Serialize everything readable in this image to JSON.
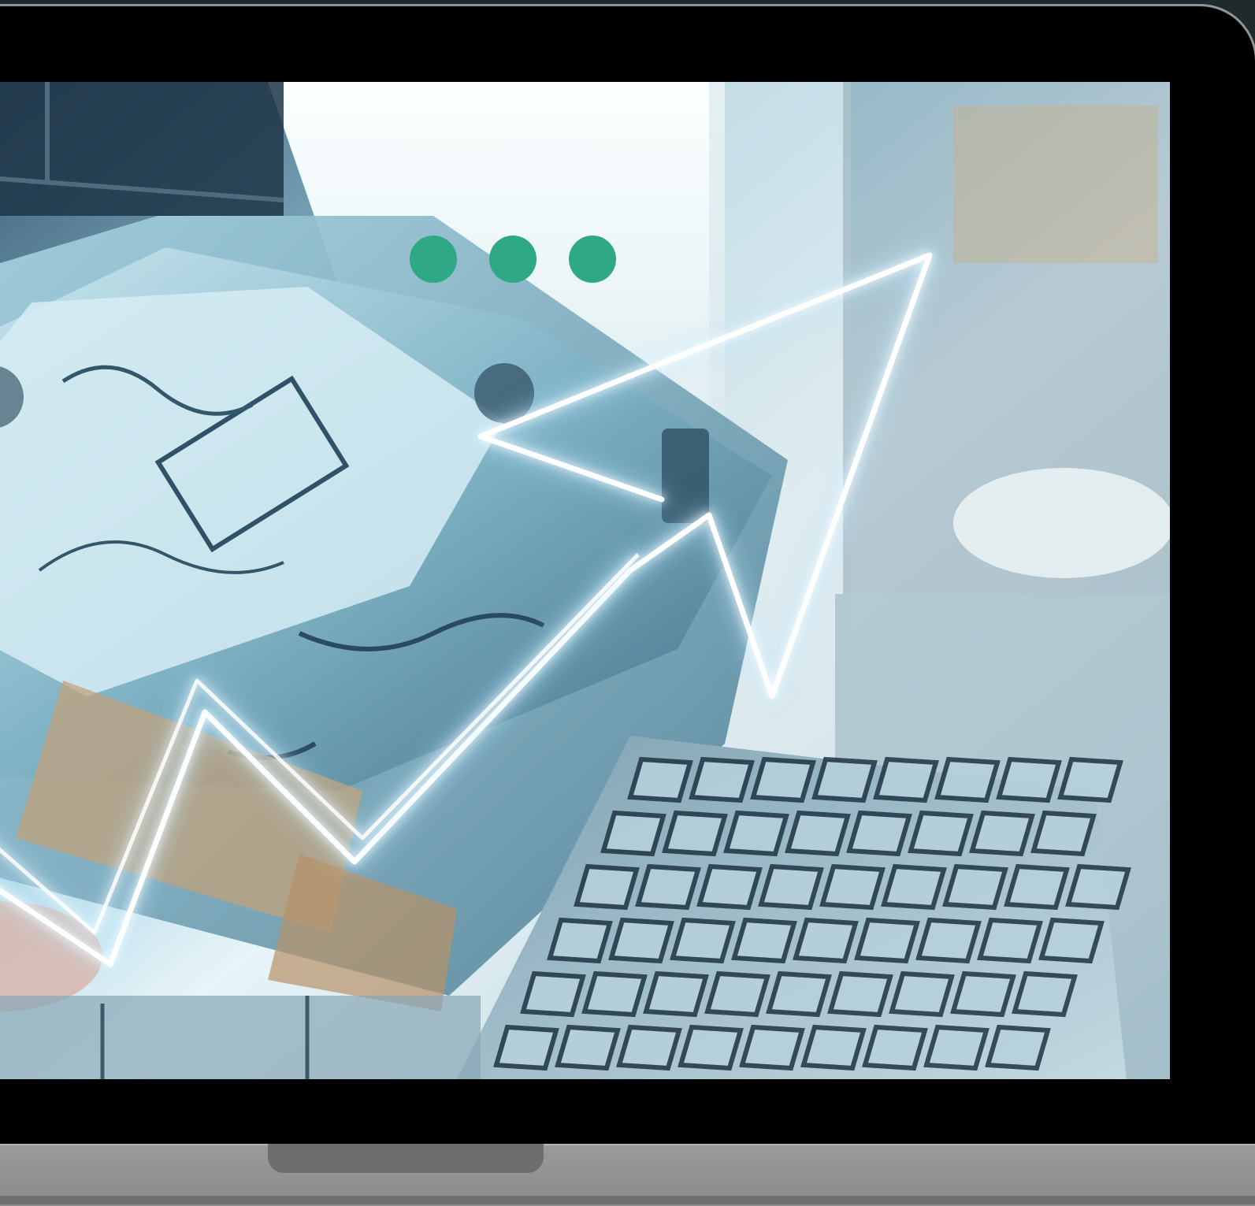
{
  "page": {
    "description": "",
    "window_dots": [
      "dot-1",
      "dot-2",
      "dot-3"
    ]
  },
  "colors": {
    "frame": "#000000",
    "accent_dots": "#2ea885",
    "base": "#8a8a8a",
    "screen_tint": "#9fd3e6"
  },
  "icons": [
    "window-control-dot",
    "trend-arrow-icon",
    "laptop-keyboard"
  ]
}
